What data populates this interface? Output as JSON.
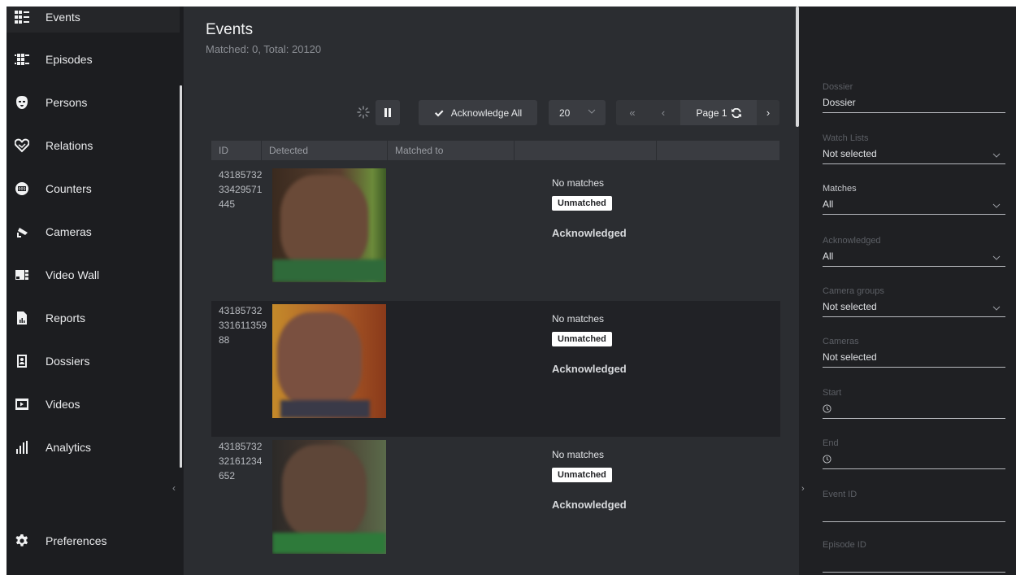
{
  "nav": {
    "items": [
      {
        "label": "Events",
        "icon": "events-icon"
      },
      {
        "label": "Episodes",
        "icon": "episodes-icon"
      },
      {
        "label": "Persons",
        "icon": "persons-icon"
      },
      {
        "label": "Relations",
        "icon": "relations-icon"
      },
      {
        "label": "Counters",
        "icon": "counters-icon"
      },
      {
        "label": "Cameras",
        "icon": "cameras-icon"
      },
      {
        "label": "Video Wall",
        "icon": "video-wall-icon"
      },
      {
        "label": "Reports",
        "icon": "reports-icon"
      },
      {
        "label": "Dossiers",
        "icon": "dossiers-icon"
      },
      {
        "label": "Videos",
        "icon": "videos-icon"
      },
      {
        "label": "Analytics",
        "icon": "analytics-icon"
      }
    ],
    "preferences": {
      "label": "Preferences",
      "icon": "gear-icon"
    },
    "collapse_glyph": "‹"
  },
  "page": {
    "title": "Events",
    "subtitle": "Matched: 0, Total: 20120"
  },
  "toolbar": {
    "acknowledge_all": "Acknowledge All",
    "page_size": "20",
    "first_glyph": "«",
    "prev_glyph": "‹",
    "next_glyph": "›",
    "page_label": "Page 1"
  },
  "table": {
    "columns": [
      "ID",
      "Detected",
      "Matched to",
      "",
      ""
    ],
    "rows": [
      {
        "id": "4318573233429571445",
        "status": "No matches",
        "badge": "Unmatched",
        "ack": "Acknowledged"
      },
      {
        "id": "4318573233161135988",
        "status": "No matches",
        "badge": "Unmatched",
        "ack": "Acknowledged"
      },
      {
        "id": "4318573232161234652",
        "status": "No matches",
        "badge": "Unmatched",
        "ack": "Acknowledged"
      }
    ]
  },
  "filters": {
    "expand_glyph": "›",
    "dossier": {
      "label": "Dossier",
      "value": "Dossier"
    },
    "watch_lists": {
      "label": "Watch Lists",
      "value": "Not selected"
    },
    "matches": {
      "label": "Matches",
      "value": "All"
    },
    "acknowledged": {
      "label": "Acknowledged",
      "value": "All"
    },
    "camera_groups": {
      "label": "Camera groups",
      "value": "Not selected"
    },
    "cameras": {
      "label": "Cameras",
      "value": "Not selected"
    },
    "start": {
      "label": "Start"
    },
    "end": {
      "label": "End"
    },
    "event_id": {
      "label": "Event ID"
    },
    "episode_id": {
      "label": "Episode ID"
    }
  },
  "colors": {
    "sidebar_bg": "#1c1d20",
    "main_bg": "#2b2d31",
    "button_bg": "#3a3c41",
    "badge_bg": "#ffffff"
  }
}
